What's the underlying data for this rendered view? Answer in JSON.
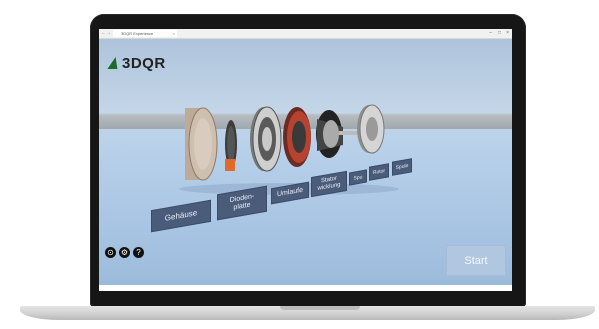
{
  "browser": {
    "tab_title": "3DQR Experience",
    "tab_close": "×",
    "back": "←",
    "forward": "→",
    "window_controls": [
      "–",
      "□",
      "×"
    ]
  },
  "app": {
    "logo_text": "3DQR"
  },
  "parts": [
    {
      "label": "Gehäuse"
    },
    {
      "label": "Dioden-\nplatte"
    },
    {
      "label": "Umlaufe"
    },
    {
      "label": "Stator\nwicklung"
    },
    {
      "label": "Spu"
    },
    {
      "label": "Rotor"
    },
    {
      "label": "Spule"
    }
  ],
  "controls": {
    "icon_1": "⊙",
    "icon_2": "⚙",
    "icon_3": "?",
    "start_label": "Start"
  },
  "colors": {
    "label_bg": "#4a5c7a",
    "logo_mark": "#1d6b2b"
  }
}
